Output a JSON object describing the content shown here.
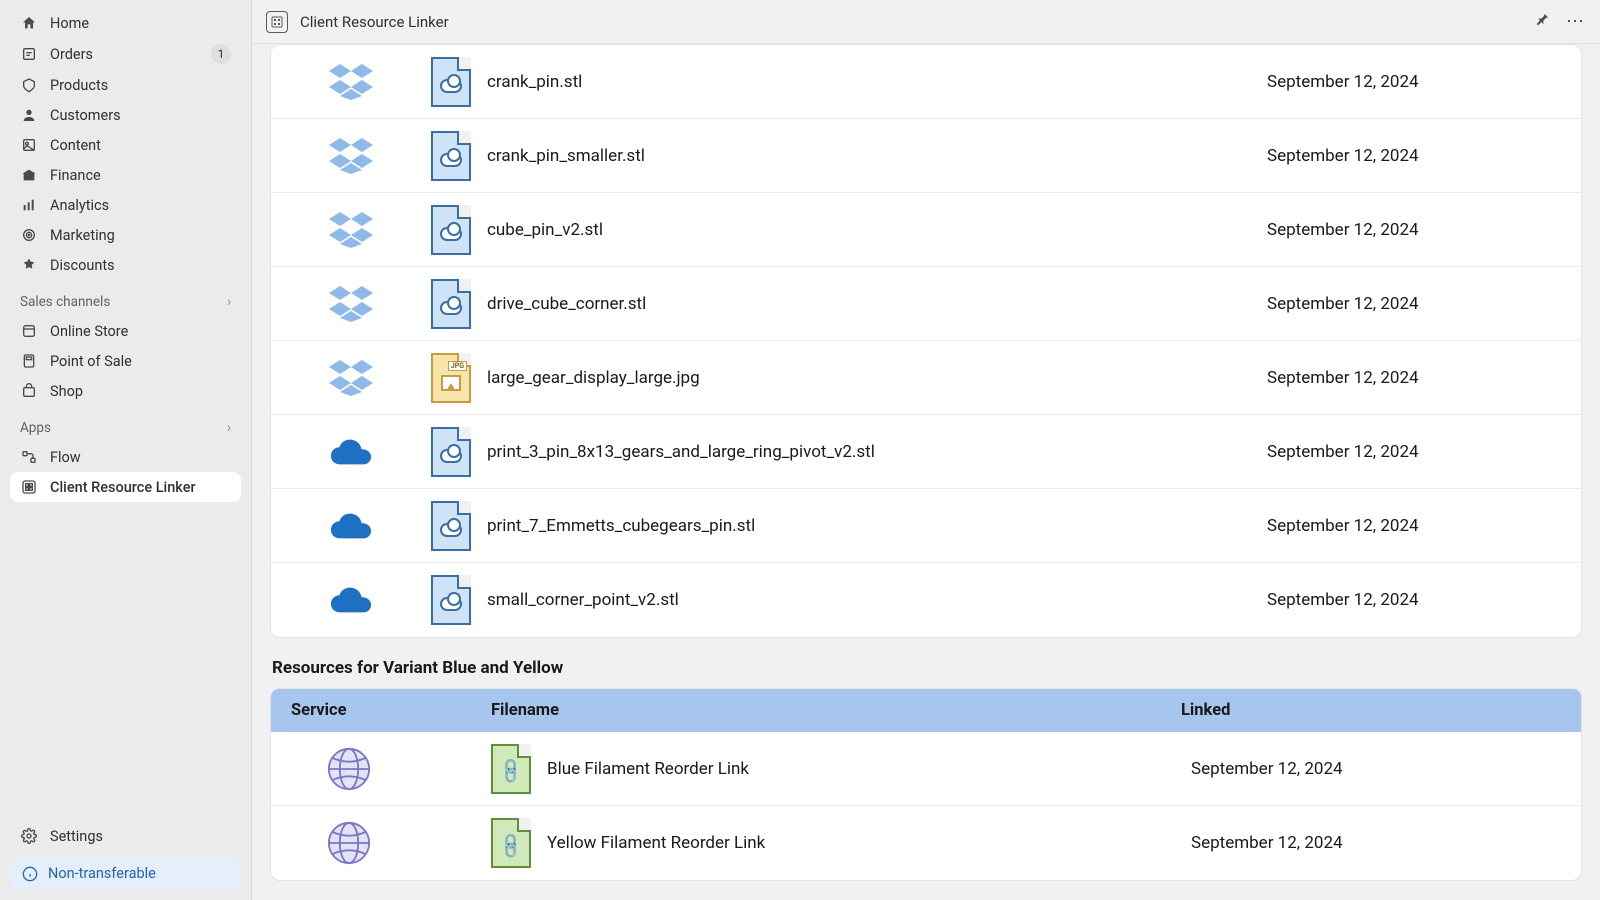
{
  "sidebar": {
    "nav": [
      {
        "icon": "home",
        "label": "Home"
      },
      {
        "icon": "orders",
        "label": "Orders",
        "badge": "1"
      },
      {
        "icon": "products",
        "label": "Products"
      },
      {
        "icon": "customers",
        "label": "Customers"
      },
      {
        "icon": "content",
        "label": "Content"
      },
      {
        "icon": "finance",
        "label": "Finance"
      },
      {
        "icon": "analytics",
        "label": "Analytics"
      },
      {
        "icon": "marketing",
        "label": "Marketing"
      },
      {
        "icon": "discounts",
        "label": "Discounts"
      }
    ],
    "sales_header": "Sales channels",
    "sales": [
      {
        "icon": "store",
        "label": "Online Store"
      },
      {
        "icon": "pos",
        "label": "Point of Sale"
      },
      {
        "icon": "shop",
        "label": "Shop"
      }
    ],
    "apps_header": "Apps",
    "apps": [
      {
        "icon": "flow",
        "label": "Flow"
      },
      {
        "icon": "crl",
        "label": "Client Resource Linker",
        "active": true
      }
    ],
    "settings": "Settings",
    "nontransferable": "Non-transferable"
  },
  "titlebar": {
    "title": "Client Resource Linker"
  },
  "files": [
    {
      "service": "dropbox",
      "type": "cloud",
      "name": "crank_pin.stl",
      "date": "September 12, 2024"
    },
    {
      "service": "dropbox",
      "type": "cloud",
      "name": "crank_pin_smaller.stl",
      "date": "September 12, 2024"
    },
    {
      "service": "dropbox",
      "type": "cloud",
      "name": "cube_pin_v2.stl",
      "date": "September 12, 2024"
    },
    {
      "service": "dropbox",
      "type": "cloud",
      "name": "drive_cube_corner.stl",
      "date": "September 12, 2024"
    },
    {
      "service": "dropbox",
      "type": "jpg",
      "name": "large_gear_display_large.jpg",
      "date": "September 12, 2024"
    },
    {
      "service": "onedrive",
      "type": "cloud",
      "name": "print_3_pin_8x13_gears_and_large_ring_pivot_v2.stl",
      "date": "September 12, 2024"
    },
    {
      "service": "onedrive",
      "type": "cloud",
      "name": "print_7_Emmetts_cubegears_pin.stl",
      "date": "September 12, 2024"
    },
    {
      "service": "onedrive",
      "type": "cloud",
      "name": "small_corner_point_v2.stl",
      "date": "September 12, 2024"
    }
  ],
  "variant_section": {
    "title": "Resources for Variant Blue and Yellow",
    "columns": {
      "service": "Service",
      "filename": "Filename",
      "linked": "Linked"
    },
    "rows": [
      {
        "service": "web",
        "type": "link",
        "name": "Blue Filament Reorder Link",
        "date": "September 12, 2024"
      },
      {
        "service": "web",
        "type": "link",
        "name": "Yellow Filament Reorder Link",
        "date": "September 12, 2024"
      }
    ]
  }
}
